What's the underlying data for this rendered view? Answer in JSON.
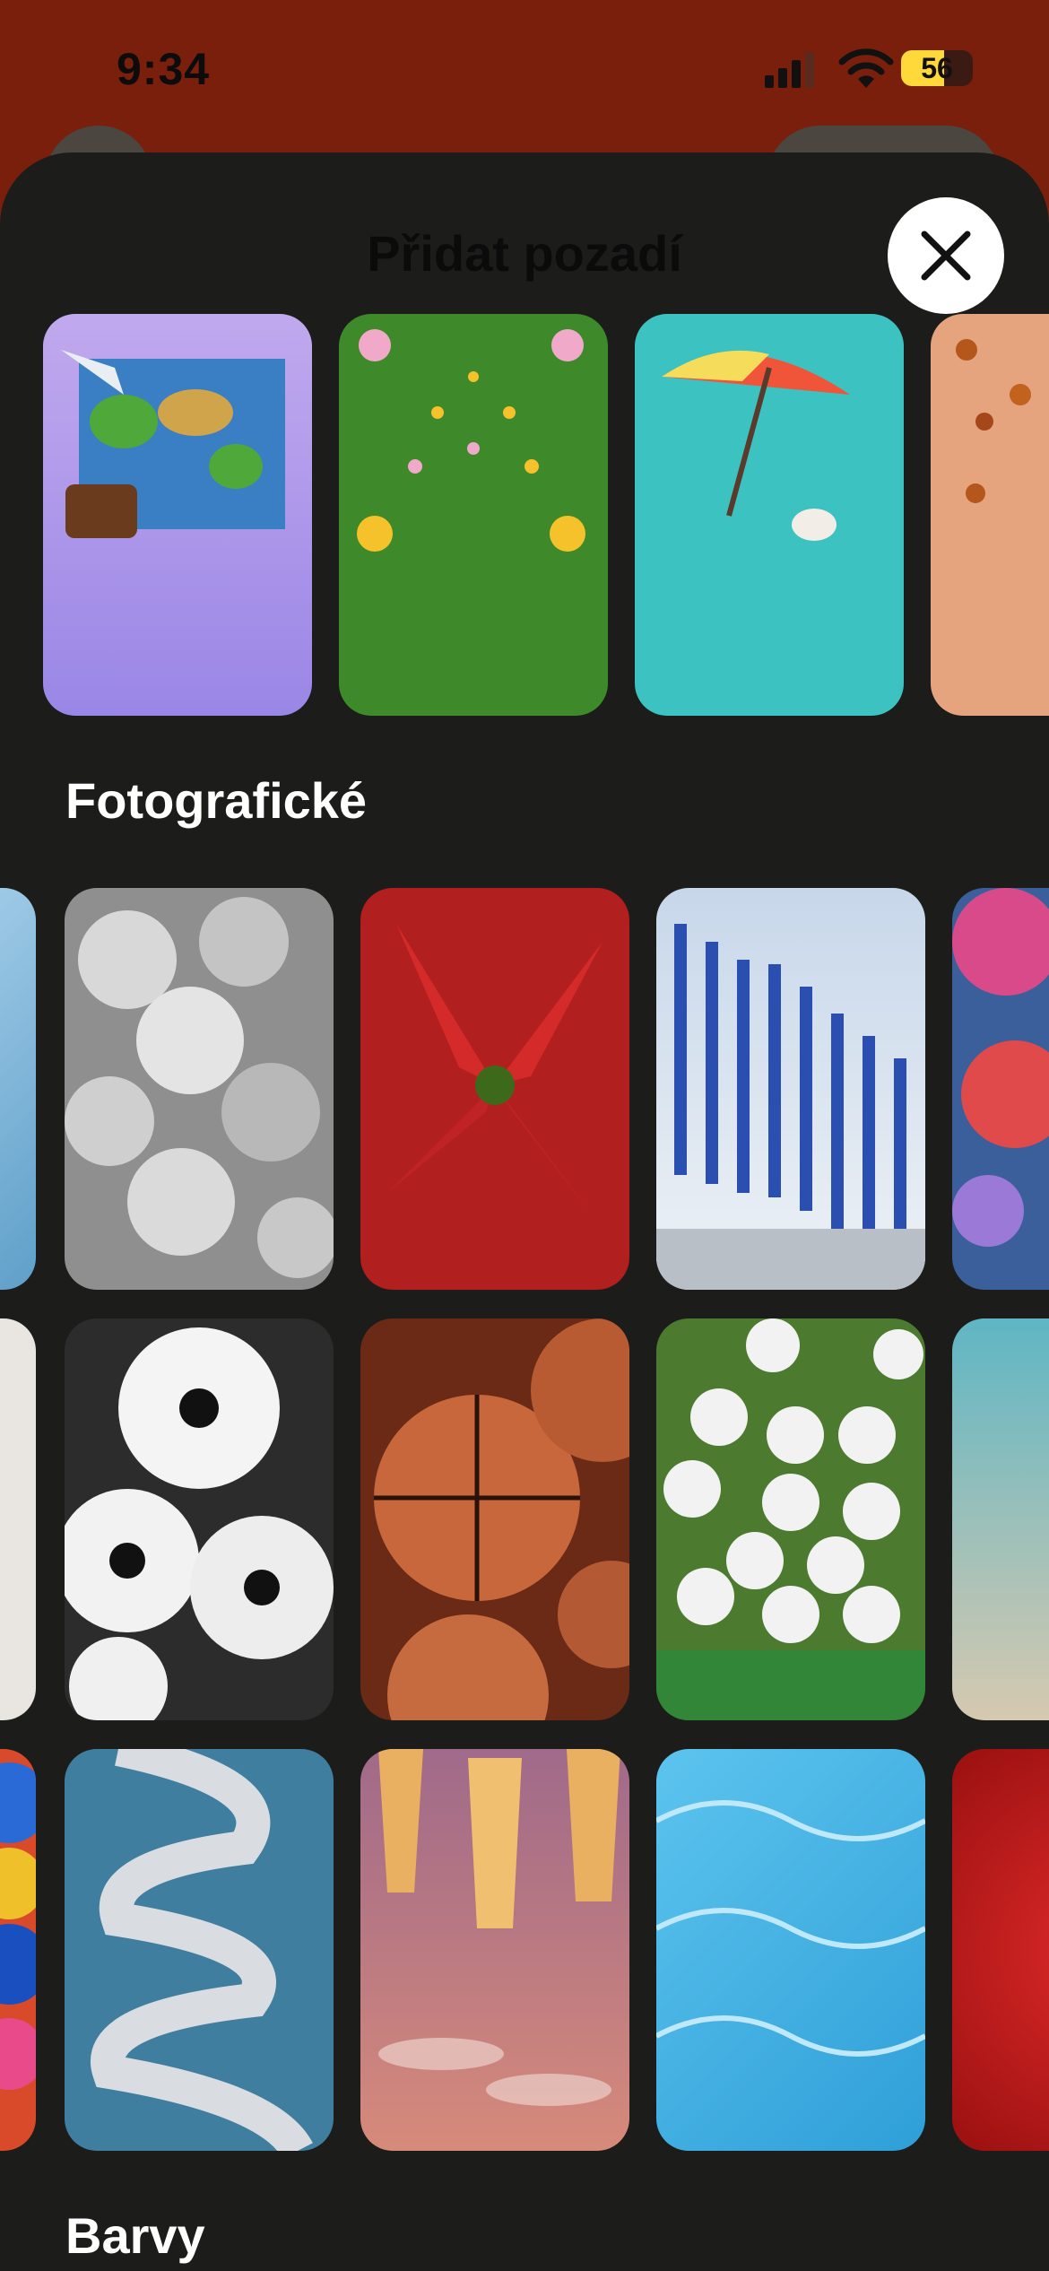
{
  "status_bar": {
    "time": "9:34",
    "battery": "56",
    "battery_level": 0.56
  },
  "sheet": {
    "title": "Přidat pozadí",
    "close_icon": "close-icon"
  },
  "featured": [
    {
      "name": "travel-map-wallpaper",
      "background": "#a88ee8"
    },
    {
      "name": "flowers-wallpaper",
      "background": "#3e8a2a"
    },
    {
      "name": "beach-umbrella-wallpaper",
      "background": "#3cc2c0"
    },
    {
      "name": "autumn-leaves-wallpaper",
      "background": "#e6a47e"
    }
  ],
  "sections": {
    "photographic": "Fotografické",
    "colors": "Barvy"
  },
  "photos": [
    [
      "snow",
      "christmas-ornaments",
      "poinsettia",
      "menorah-candles",
      "flowers-fabric"
    ],
    [
      "baseballs",
      "soccer-balls",
      "basketballs",
      "golf-balls",
      "sea-water"
    ],
    [
      "balloons",
      "ribbon",
      "champagne-glasses",
      "pool-tiles",
      "red-rose"
    ]
  ]
}
